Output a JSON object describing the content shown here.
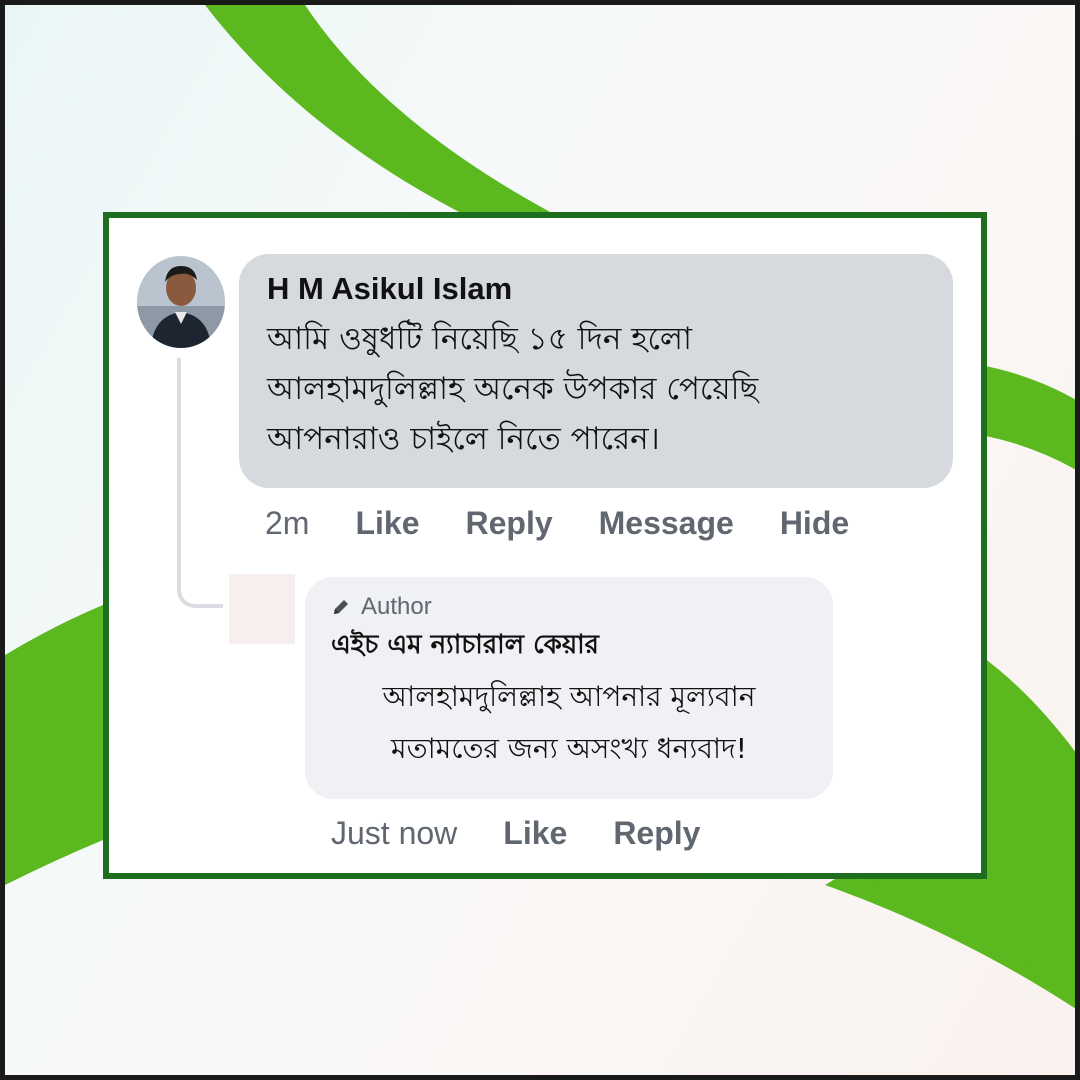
{
  "colors": {
    "accent_green": "#5cb81f",
    "card_border": "#1f6e1f",
    "comment_bubble": "#d6d9de",
    "reply_bubble": "#f0f1f4",
    "action_text": "#616770"
  },
  "comment": {
    "author_name": "H M Asikul Islam",
    "text_lines": [
      "আমি ওষুধটি নিয়েছি ১৫ দিন হলো",
      "আলহামদুলিল্লাহ অনেক উপকার পেয়েছি",
      "আপনারাও চাইলে নিতে পারেন।"
    ],
    "actions": {
      "time": "2m",
      "like": "Like",
      "reply": "Reply",
      "message": "Message",
      "hide": "Hide"
    }
  },
  "reply": {
    "badge_icon": "pencil-icon",
    "badge_label": "Author",
    "author_name": "এইচ এম ন্যাচারাল কেয়ার",
    "text_lines": [
      "আলহামদুলিল্লাহ আপনার মূল্যবান",
      "মতামতের জন্য অসংখ্য ধন্যবাদ!"
    ],
    "actions": {
      "time": "Just now",
      "like": "Like",
      "reply": "Reply"
    }
  }
}
